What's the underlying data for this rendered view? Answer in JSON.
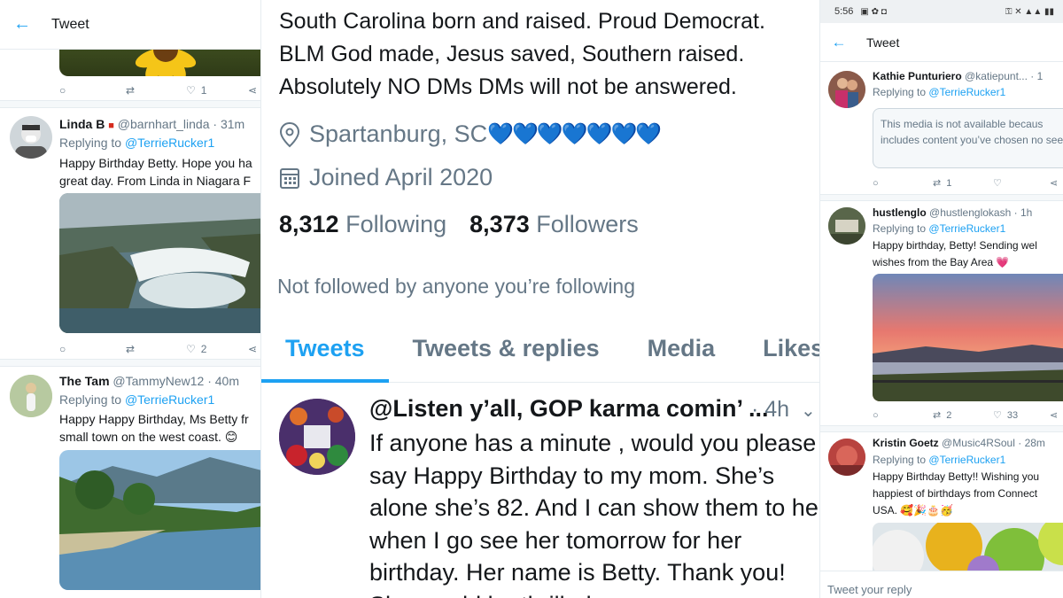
{
  "left": {
    "header_title": "Tweet",
    "tweet1": {
      "like_count": "1"
    },
    "tweet2": {
      "name": "Linda B",
      "handle": "@barnhart_linda",
      "time": "· 31m",
      "replying_prefix": "Replying to",
      "replying_handle": "@TerrieRucker1",
      "text_line1": "Happy Birthday Betty. Hope you ha",
      "text_line2": "great day. From Linda in Niagara F",
      "like_count": "2"
    },
    "tweet3": {
      "name": "The Tam",
      "handle": "@TammyNew12",
      "time": "· 40m",
      "replying_prefix": "Replying to",
      "replying_handle": "@TerrieRucker1",
      "text_line1": "Happy Happy Birthday, Ms Betty fr",
      "text_line2": "small town on the west coast."
    }
  },
  "middle": {
    "bio_line1": "South Carolina born and raised. Proud Democrat.",
    "bio_line2": "BLM God made, Jesus saved, Southern raised.",
    "bio_line3": "Absolutely NO DMs DMs will not be answered.",
    "location": "Spartanburg, SC",
    "location_hearts": "💙💙💙💙💙💙💙",
    "joined": "Joined April 2020",
    "following_count": "8,312",
    "following_label": "Following",
    "followers_count": "8,373",
    "followers_label": "Followers",
    "not_followed": "Not followed by anyone you’re following",
    "tabs": [
      "Tweets",
      "Tweets & replies",
      "Media",
      "Likes"
    ],
    "tweet": {
      "name": "@Listen y’all, GOP karma comin’ ...",
      "time": "· 4h",
      "text": "If anyone has a minute , would you please say Happy Birthday to my mom. She’s alone she’s 82. And I can show them to her when I go see her tomorrow for her birthday. Her name is Betty. Thank you! She would be thrilled."
    }
  },
  "right": {
    "status_time": "5:56",
    "header_title": "Tweet",
    "tweet1": {
      "name": "Kathie Punturiero",
      "handle": "@katiepunt...",
      "time": "· 1",
      "replying_prefix": "Replying to",
      "replying_handle": "@TerrieRucker1",
      "unavailable_text": "This media is not available becaus includes content you’ve chosen no see.",
      "retweet_count": "1"
    },
    "tweet2": {
      "name": "hustlenglo",
      "handle": "@hustlenglokash",
      "time": "· 1h",
      "replying_prefix": "Replying to",
      "replying_handle": "@TerrieRucker1",
      "text_line1": "Happy birthday, Betty! Sending wel",
      "text_line2": "wishes from the Bay Area 💗",
      "retweet_count": "2",
      "like_count": "33"
    },
    "tweet3": {
      "name": "Kristin Goetz",
      "handle": "@Music4RSoul",
      "time": "· 28m",
      "replying_prefix": "Replying to",
      "replying_handle": "@TerrieRucker1",
      "text_line1": "Happy Birthday Betty!! Wishing you",
      "text_line2": "happiest of birthdays from Connect",
      "text_line3": "USA. 🥰🎉🎂🥳"
    },
    "reply_placeholder": "Tweet your reply"
  }
}
